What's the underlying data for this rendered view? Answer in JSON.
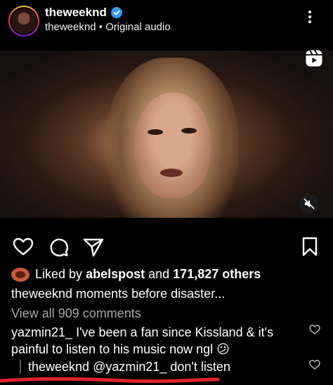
{
  "header": {
    "username": "theweeknd",
    "audio_line": "theweeknd • Original audio"
  },
  "post": {
    "likes_prefix": "Liked by",
    "liked_by_user": "abelspost",
    "and_text": "and",
    "likes_count": "171,827 others",
    "caption_user": "theweeknd",
    "caption_text": "moments before disaster...",
    "view_comments": "View all 909 comments"
  },
  "comments": [
    {
      "user": "yazmin21_",
      "text": "I've been a fan since Kissland & it's painful to listen to his music now ngl 😕"
    },
    {
      "user": "theweeknd",
      "text": "@yazmin21_ don't listen"
    }
  ],
  "icons": {
    "like": "heart-icon",
    "comment": "comment-icon",
    "share": "send-icon",
    "save": "bookmark-icon",
    "reels": "reels-icon",
    "mute": "muted-speaker-icon",
    "more": "more-vertical-icon",
    "verified": "verified-badge-icon"
  },
  "colors": {
    "background": "#000000",
    "verified": "#3897f0",
    "muted_text": "#a8a8a8",
    "annotation": "#e0242a"
  }
}
